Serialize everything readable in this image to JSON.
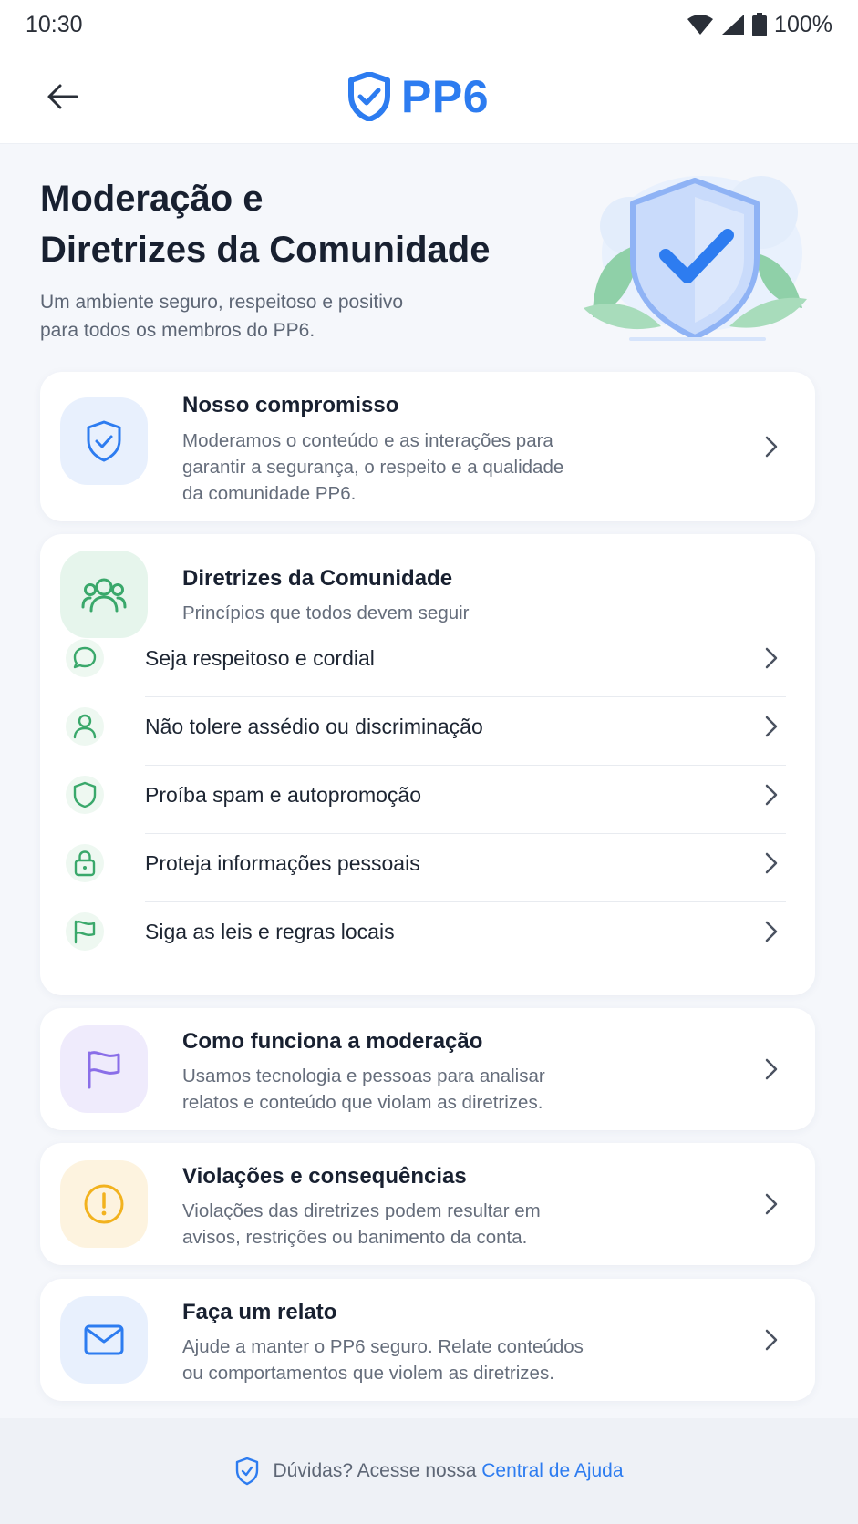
{
  "status_bar": {
    "time": "10:30",
    "battery": "100%"
  },
  "app_bar": {
    "brand": "PP6"
  },
  "hero": {
    "title_line1": "Moderação e",
    "title_line2": "Diretrizes da Comunidade",
    "subtitle_line1": "Um ambiente seguro, respeitoso e positivo",
    "subtitle_line2": "para todos os membros do PP6."
  },
  "commitment": {
    "title": "Nosso compromisso",
    "desc_line1": "Moderamos o conteúdo e as interações para",
    "desc_line2": "garantir a segurança, o respeito e a qualidade",
    "desc_line3": "da comunidade PP6."
  },
  "guidelines": {
    "title": "Diretrizes da Comunidade",
    "subtitle": "Princípios que todos devem seguir",
    "items": [
      {
        "label": "Seja respeitoso e cordial",
        "icon": "chat-bubble-icon"
      },
      {
        "label": "Não tolere assédio ou discriminação",
        "icon": "user-icon"
      },
      {
        "label": "Proíba spam e autopromoção",
        "icon": "shield-icon"
      },
      {
        "label": "Proteja informações pessoais",
        "icon": "lock-icon"
      },
      {
        "label": "Siga as leis e regras locais",
        "icon": "flag-icon"
      }
    ]
  },
  "moderation": {
    "title": "Como funciona a moderação",
    "desc_line1": "Usamos tecnologia e pessoas para analisar",
    "desc_line2": "relatos e conteúdo que violam as diretrizes."
  },
  "violations": {
    "title": "Violações e consequências",
    "desc_line1": "Violações das diretrizes podem resultar em",
    "desc_line2": "avisos, restrições ou banimento da conta."
  },
  "report": {
    "title": "Faça um relato",
    "desc_line1": "Ajude a manter o PP6 seguro. Relate conteúdos",
    "desc_line2": "ou comportamentos que violem as diretrizes."
  },
  "footer": {
    "text": "Dúvidas? Acesse nossa",
    "link": "Central de Ajuda"
  },
  "colors": {
    "brand_blue": "#2d7cf0",
    "green": "#3aa86b",
    "purple": "#8a6ee8",
    "amber": "#f2b21e"
  }
}
